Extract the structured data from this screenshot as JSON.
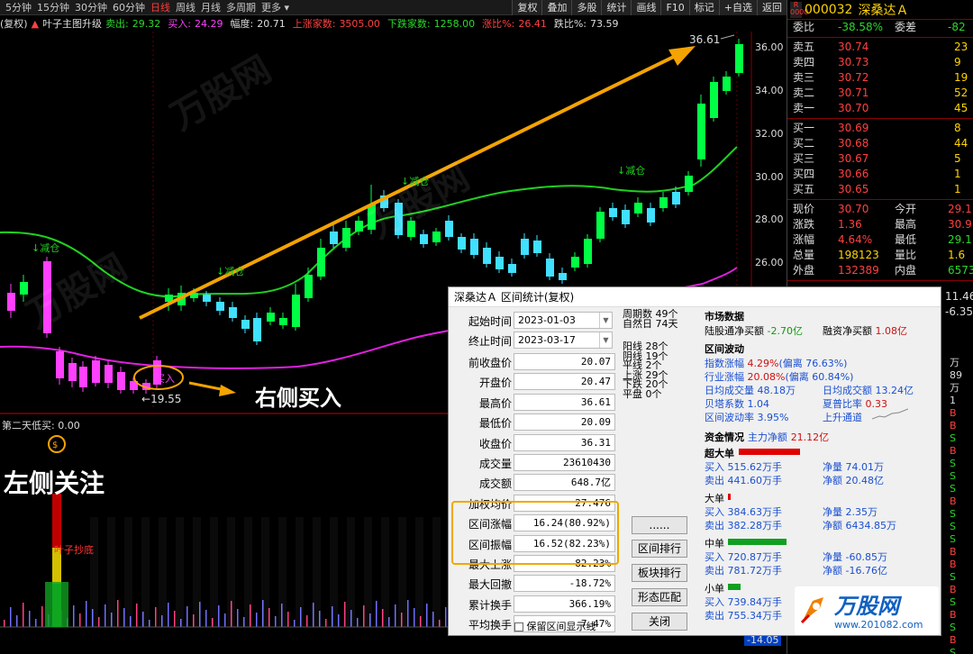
{
  "toolbar": {
    "periods": [
      "5分钟",
      "15分钟",
      "30分钟",
      "60分钟",
      "日线",
      "周线",
      "月线",
      "多周期",
      "更多 ▾"
    ],
    "active_period": "日线",
    "buttons": [
      "复权",
      "叠加",
      "多股",
      "统计",
      "画线",
      "F10",
      "标记",
      "+自选",
      "返回"
    ]
  },
  "indicator_line": {
    "prefix": "(复权)",
    "name": "叶子主图升级",
    "sell_label": "卖出:",
    "sell_value": "29.32",
    "buy_label": "买入:",
    "buy_value": "24.29",
    "range_label": "幅度:",
    "range_value": "20.71",
    "up_label": "上涨家数:",
    "up_value": "3505.00",
    "down_label": "下跌家数:",
    "down_value": "1258.00",
    "rise_label": "涨比%:",
    "rise_value": "26.41",
    "fall_label": "跌比%:",
    "fall_value": "73.59"
  },
  "price_axis": [
    "36.00",
    "34.00",
    "32.00",
    "30.00",
    "28.00",
    "26.00"
  ],
  "chart_marks": {
    "high_price": "36.61",
    "low_price": "19.55",
    "reduce_1": "↓减仓",
    "reduce_2": "↓减仓",
    "reduce_3": "↓减仓",
    "reduce_4": "↓减仓",
    "buy_mark": "买入"
  },
  "annotations": {
    "right_buy": "右侧买入",
    "left_focus": "左侧关注",
    "sub_indicator": "第二天低买: 0.00",
    "sub_label": "叶子抄底"
  },
  "quote": {
    "code": "000032",
    "name": "深桑达Ａ",
    "ratio_label": "委比",
    "ratio_value": "-38.58%",
    "diff_label": "委差",
    "diff_value": "-82",
    "asks": [
      {
        "label": "卖五",
        "price": "30.74",
        "vol": "23"
      },
      {
        "label": "卖四",
        "price": "30.73",
        "vol": "9"
      },
      {
        "label": "卖三",
        "price": "30.72",
        "vol": "19"
      },
      {
        "label": "卖二",
        "price": "30.71",
        "vol": "52"
      },
      {
        "label": "卖一",
        "price": "30.70",
        "vol": "45"
      }
    ],
    "bids": [
      {
        "label": "买一",
        "price": "30.69",
        "vol": "8"
      },
      {
        "label": "买二",
        "price": "30.68",
        "vol": "44"
      },
      {
        "label": "买三",
        "price": "30.67",
        "vol": "5"
      },
      {
        "label": "买四",
        "price": "30.66",
        "vol": "1"
      },
      {
        "label": "买五",
        "price": "30.65",
        "vol": "1"
      }
    ],
    "stats": [
      {
        "l": "现价",
        "v": "30.70",
        "l2": "今开",
        "v2": "29.1"
      },
      {
        "l": "涨跌",
        "v": "1.36",
        "l2": "最高",
        "v2": "30.9"
      },
      {
        "l": "涨幅",
        "v": "4.64%",
        "l2": "最低",
        "v2": "29.1"
      },
      {
        "l": "总量",
        "v": "198123",
        "l2": "量比",
        "v2": "1.6"
      },
      {
        "l": "外盘",
        "v": "132389",
        "l2": "内盘",
        "v2": "6573"
      }
    ],
    "side_values": [
      "11.46",
      "-6.35"
    ],
    "tick_tail": [
      "万",
      "89",
      "万",
      "1",
      "B",
      "B",
      "S",
      "B",
      "S",
      "S",
      "S",
      "B",
      "S",
      "S",
      "S",
      "B",
      "B",
      "S",
      "B",
      "S",
      "B",
      "S",
      "B",
      "S"
    ],
    "bottom_price": "-14.05"
  },
  "dialog": {
    "title": "深桑达Ａ  区间统计(复权)",
    "start_label": "起始时间",
    "start_value": "2023-01-03",
    "end_label": "终止时间",
    "end_value": "2023-03-17",
    "fields": [
      {
        "label": "前收盘价",
        "value": "20.07"
      },
      {
        "label": "开盘价",
        "value": "20.47"
      },
      {
        "label": "最高价",
        "value": "36.61"
      },
      {
        "label": "最低价",
        "value": "20.09"
      },
      {
        "label": "收盘价",
        "value": "36.31"
      },
      {
        "label": "成交量",
        "value": "23610430"
      },
      {
        "label": "成交额",
        "value": "648.7亿"
      },
      {
        "label": "加权均价",
        "value": "27.476"
      },
      {
        "label": "区间涨幅",
        "value": "16.24(80.92%)"
      },
      {
        "label": "区间振幅",
        "value": "16.52(82.23%)"
      },
      {
        "label": "最大上涨",
        "value": "82.23%"
      },
      {
        "label": "最大回撤",
        "value": "-18.72%"
      },
      {
        "label": "累计换手",
        "value": "366.19%"
      },
      {
        "label": "平均换手",
        "value": "7.47%"
      }
    ],
    "period_count": "周期数",
    "period_value": "49个",
    "natural_days": "自然日",
    "natural_value": "74天",
    "counts": [
      {
        "l": "阳线",
        "v": "28个"
      },
      {
        "l": "阴线",
        "v": "19个"
      },
      {
        "l": "平线",
        "v": "2个"
      },
      {
        "l": "上涨",
        "v": "29个"
      },
      {
        "l": "下跌",
        "v": "20个"
      },
      {
        "l": "平盘",
        "v": "0个"
      }
    ],
    "buttons": {
      "dots": "......",
      "rank": "区间排行",
      "sector": "板块排行",
      "pattern": "形态匹配",
      "close": "关闭"
    },
    "checkbox_label": "保留区间显示线",
    "market": {
      "title": "市场数据",
      "hk_label": "陆股通净买额",
      "hk_value": "-2.70亿",
      "margin_label": "融资净买额",
      "margin_value": "1.08亿"
    },
    "volatility": {
      "title": "区间波动",
      "index_label": "指数涨幅",
      "index_value": "4.29%",
      "index_dev": "(偏离 76.63%)",
      "industry_label": "行业涨幅",
      "industry_value": "20.08%",
      "industry_dev": "(偏离 60.84%)",
      "avgvol_label": "日均成交量",
      "avgvol_value": "48.18万",
      "avgamt_label": "日均成交额",
      "avgamt_value": "13.24亿",
      "beta_label": "贝塔系数",
      "beta_value": "1.04",
      "sharpe_label": "夏普比率",
      "sharpe_value": "0.33",
      "vola_label": "区间波动率",
      "vola_value": "3.95%",
      "trend_label": "上升通道"
    },
    "funds": {
      "title": "资金情况",
      "main_label": "主力净额",
      "main_value": "21.12亿",
      "xl": {
        "name": "超大单",
        "buy": "515.62万手",
        "sell": "441.60万手",
        "net": "74.01万",
        "netamt": "20.48亿"
      },
      "l": {
        "name": "大单",
        "buy": "384.63万手",
        "sell": "382.28万手",
        "net": "2.35万",
        "netamt": "6434.85万"
      },
      "m": {
        "name": "中单",
        "buy": "720.87万手",
        "sell": "781.72万手",
        "net": "-60.85万",
        "netamt": "-16.76亿"
      },
      "s": {
        "name": "小单",
        "buy": "739.84万手",
        "sell": "755.34万手"
      },
      "buy_label": "买入",
      "sell_label": "卖出",
      "net_label": "净量",
      "netamt_label": "净额"
    }
  },
  "watermark": {
    "brand": "万股网",
    "url": "www.201082.com"
  }
}
